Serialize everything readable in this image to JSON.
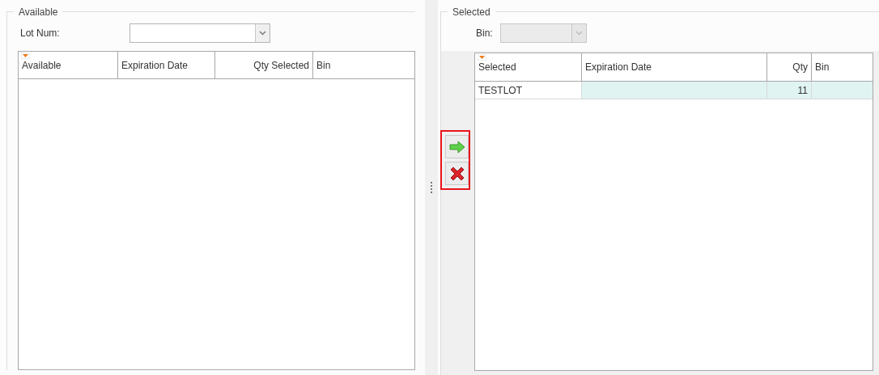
{
  "available": {
    "title": "Available",
    "lot_field": {
      "label": "Lot Num:",
      "disabled": false
    },
    "table": {
      "columns": [
        {
          "label": "Available",
          "numeric": false,
          "indicator": true
        },
        {
          "label": "Expiration Date",
          "numeric": false,
          "indicator": false
        },
        {
          "label": "Qty Selected",
          "numeric": true,
          "indicator": false
        },
        {
          "label": "Bin",
          "numeric": false,
          "indicator": false
        }
      ]
    }
  },
  "actions": {
    "highlighted": true,
    "buttons": [
      {
        "kind": "add"
      },
      {
        "kind": "remove"
      }
    ]
  },
  "selected": {
    "title": "Selected",
    "bin_field": {
      "label": "Bin:",
      "disabled": true
    },
    "table": {
      "columns": [
        {
          "label": "Selected",
          "numeric": false,
          "indicator": true
        },
        {
          "label": "Expiration Date",
          "numeric": false,
          "indicator": false
        },
        {
          "label": "Qty",
          "numeric": true,
          "indicator": false
        },
        {
          "label": "Bin",
          "numeric": false,
          "indicator": false
        }
      ],
      "rows": [
        {
          "selected": true,
          "cells": [
            {
              "text": "TESTLOT",
              "focused": true
            },
            {
              "text": "",
              "focused": false
            },
            {
              "text": "11",
              "focused": false
            },
            {
              "text": "",
              "focused": false
            }
          ]
        }
      ]
    }
  }
}
